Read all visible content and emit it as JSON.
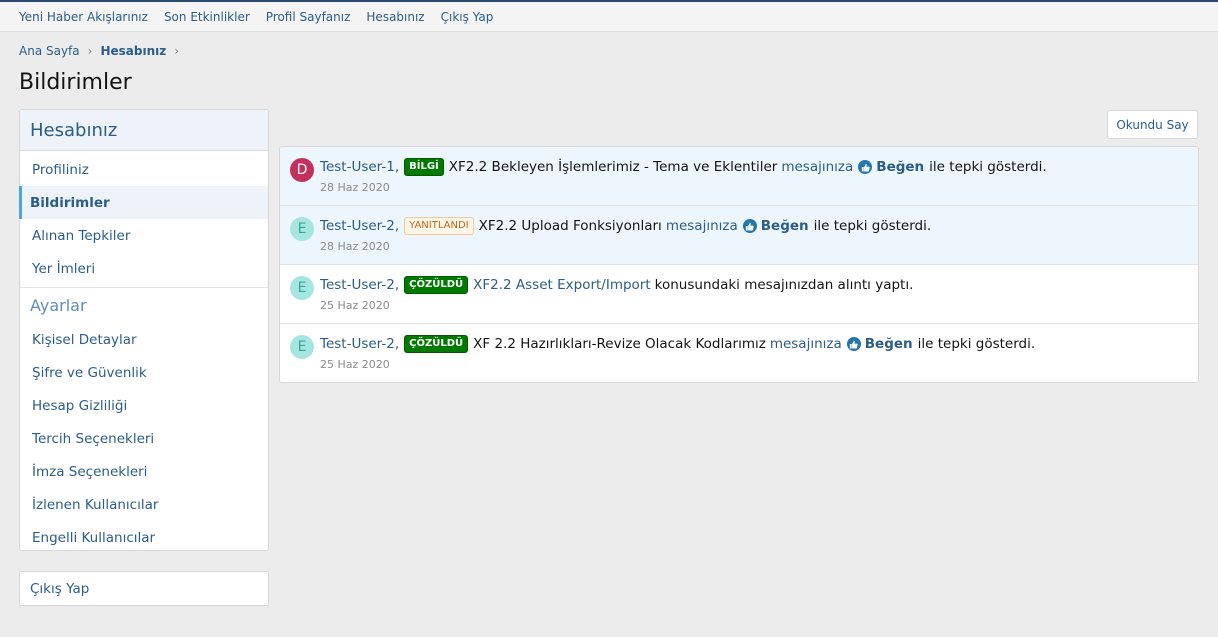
{
  "topnav": {
    "items": [
      "Yeni Haber Akışlarınız",
      "Son Etkinlikler",
      "Profil Sayfanız",
      "Hesabınız",
      "Çıkış Yap"
    ]
  },
  "breadcrumb": {
    "home": "Ana Sayfa",
    "current": "Hesabınız"
  },
  "page": {
    "title": "Bildirimler"
  },
  "sidebar": {
    "title": "Hesabınız",
    "items": [
      "Profiliniz",
      "Bildirimler",
      "Alınan Tepkiler",
      "Yer İmleri"
    ],
    "section2_title": "Ayarlar",
    "items2": [
      "Kişisel Detaylar",
      "Şifre ve Güvenlik",
      "Hesap Gizliliği",
      "Tercih Seçenekleri",
      "İmza Seçenekleri",
      "İzlenen Kullanıcılar",
      "Engelli Kullanıcılar"
    ],
    "logout": "Çıkış Yap"
  },
  "actions": {
    "mark_read": "Okundu Say"
  },
  "alerts": [
    {
      "avatar_letter": "D",
      "avatar_bg": "#c4305b",
      "avatar_fg": "#ffffff",
      "user": "Test-User-1,",
      "badge": "BİLGİ",
      "badge_style": "green",
      "thread": "XF2.2 Bekleyen İşlemlerimiz - Tema ve Eklentiler",
      "link": "mesajınıza",
      "reaction": "Beğen",
      "suffix": "ile tepki gösterdi.",
      "date": "28 Haz 2020"
    },
    {
      "avatar_letter": "E",
      "avatar_bg": "#a6e6e0",
      "avatar_fg": "#3aa597",
      "user": "Test-User-2,",
      "badge": "YANITLANDI",
      "badge_style": "orange",
      "thread": "XF2.2 Upload Fonksiyonları",
      "link": "mesajınıza",
      "reaction": "Beğen",
      "suffix": "ile tepki gösterdi.",
      "date": "28 Haz 2020"
    },
    {
      "avatar_letter": "E",
      "avatar_bg": "#a6e6e0",
      "avatar_fg": "#3aa597",
      "user": "Test-User-2,",
      "badge": "ÇÖZÜLDÜ",
      "badge_style": "green",
      "thread": "XF2.2 Asset Export/Import",
      "suffix": "konusundaki mesajınızdan alıntı yaptı.",
      "date": "25 Haz 2020"
    },
    {
      "avatar_letter": "E",
      "avatar_bg": "#a6e6e0",
      "avatar_fg": "#3aa597",
      "user": "Test-User-2,",
      "badge": "ÇÖZÜLDÜ",
      "badge_style": "green",
      "thread": "XF 2.2 Hazırlıkları-Revize Olacak Kodlarımız",
      "link": "mesajınıza",
      "reaction": "Beğen",
      "suffix": "ile tepki gösterdi.",
      "date": "25 Haz 2020"
    }
  ]
}
